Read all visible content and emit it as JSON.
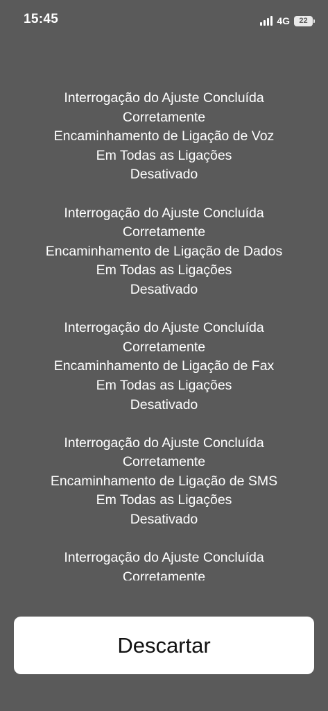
{
  "status_bar": {
    "time": "15:45",
    "network": "4G",
    "battery_level": "22",
    "signal_icon": "cellular-signal-icon",
    "battery_icon": "battery-icon"
  },
  "messages": [
    {
      "lines": [
        "Interrogação do Ajuste Concluída",
        "Corretamente",
        "Encaminhamento de Ligação de Voz",
        "Em Todas as Ligações",
        "Desativado"
      ]
    },
    {
      "lines": [
        "Interrogação do Ajuste Concluída",
        "Corretamente",
        "Encaminhamento de Ligação de Dados",
        "Em Todas as Ligações",
        "Desativado"
      ]
    },
    {
      "lines": [
        "Interrogação do Ajuste Concluída",
        "Corretamente",
        "Encaminhamento de Ligação de Fax",
        "Em Todas as Ligações",
        "Desativado"
      ]
    },
    {
      "lines": [
        "Interrogação do Ajuste Concluída",
        "Corretamente",
        "Encaminhamento de Ligação de SMS",
        "Em Todas as Ligações",
        "Desativado"
      ]
    },
    {
      "lines": [
        "Interrogação do Ajuste Concluída",
        "Corretamente"
      ]
    }
  ],
  "dismiss_button": {
    "label": "Descartar"
  }
}
